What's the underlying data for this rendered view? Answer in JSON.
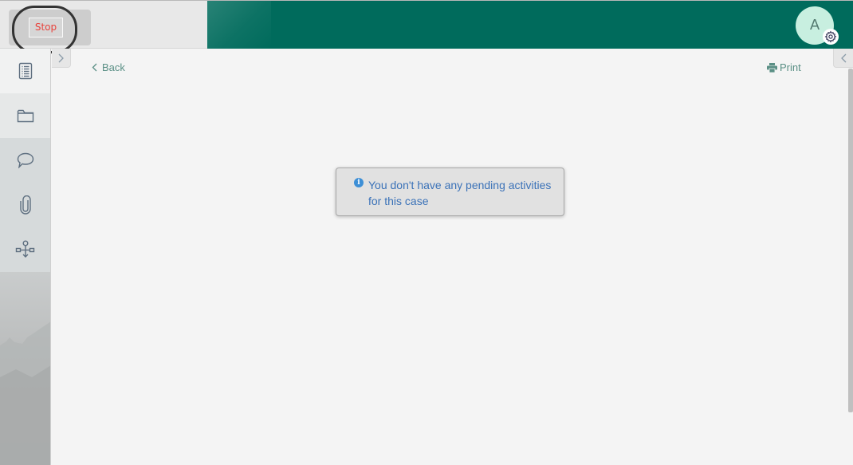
{
  "topbar": {
    "stop_label": "Stop",
    "avatar_initial": "A",
    "brand_color": "#006b5c"
  },
  "sidebar": {
    "items": [
      {
        "name": "details",
        "icon": "list-document-icon"
      },
      {
        "name": "documents",
        "icon": "folder-icon"
      },
      {
        "name": "comments",
        "icon": "speech-bubble-icon"
      },
      {
        "name": "attachments",
        "icon": "paperclip-icon"
      },
      {
        "name": "process",
        "icon": "process-flow-icon"
      }
    ]
  },
  "main": {
    "back_label": "Back",
    "print_label": "Print",
    "notice": {
      "icon": "info-icon",
      "icon_glyph": "i",
      "text": "You don't have any pending activities for this case"
    }
  }
}
